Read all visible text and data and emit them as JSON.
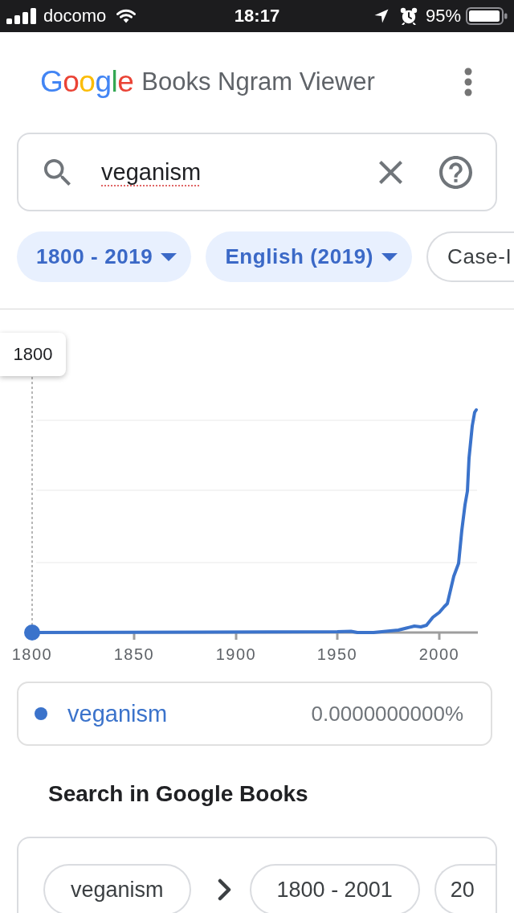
{
  "status_bar": {
    "carrier": "docomo",
    "time": "18:17",
    "battery": "95%"
  },
  "header": {
    "logo": "Google",
    "title": "Books Ngram Viewer"
  },
  "search": {
    "value": "veganism",
    "misspelled": true
  },
  "filters": [
    {
      "label": "1800 - 2019",
      "kind": "dropdown"
    },
    {
      "label": "English (2019)",
      "kind": "dropdown"
    },
    {
      "label": "Case-I",
      "kind": "toggle"
    }
  ],
  "chart": {
    "tooltip": "1800",
    "x_labels": [
      "1800",
      "1850",
      "1900",
      "1950",
      "2000"
    ]
  },
  "legend": [
    {
      "term": "veganism",
      "value": "0.0000000000%",
      "color": "#3b73cb"
    }
  ],
  "books_search": {
    "title": "Search in Google Books",
    "pills": [
      {
        "label": "veganism",
        "kind": "term"
      },
      {
        "label": "1800 - 2001",
        "kind": "range"
      },
      {
        "label": "20",
        "kind": "range"
      }
    ]
  }
}
